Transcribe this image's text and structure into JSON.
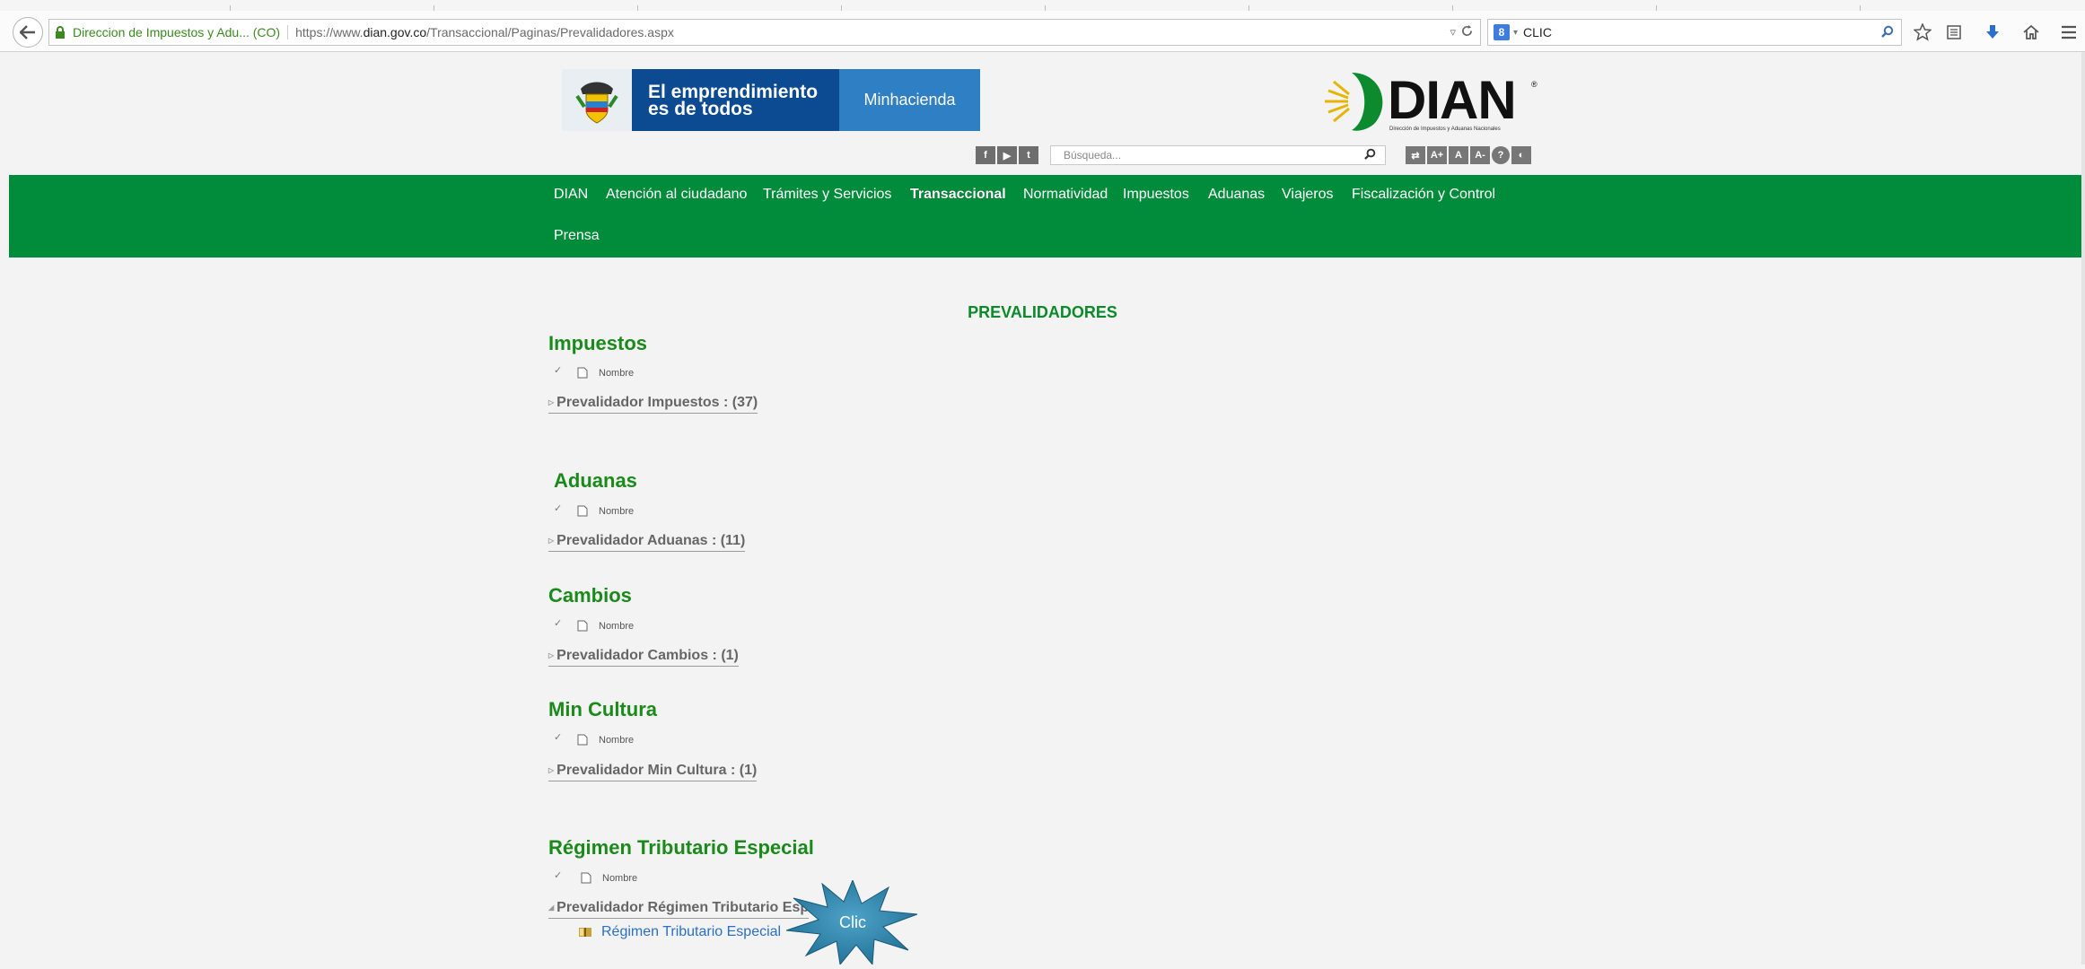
{
  "browser": {
    "identity": "Direccion de Impuestos y Adu... (CO)",
    "url_prefix": "https://www.",
    "url_domain": "dian.gov.co",
    "url_path": "/Transaccional/Paginas/Prevalidadores.aspx",
    "search_value": "CLIC",
    "search_engine_icon": "google-icon"
  },
  "header": {
    "slogan_line1": "El emprendimiento",
    "slogan_line2": "es de todos",
    "ministry": "Minhacienda",
    "dian_word": "DIAN",
    "dian_reg": "®",
    "dian_tagline": "Dirección de Impuestos y Aduanas Nacionales",
    "search_placeholder": "Búsqueda...",
    "social": [
      "f",
      "▶",
      "t"
    ],
    "access_tools": [
      "⇄",
      "A+",
      "A",
      "A-",
      "?",
      "◐"
    ]
  },
  "nav": {
    "items": [
      {
        "label": "DIAN"
      },
      {
        "label": "Atención al ciudadano"
      },
      {
        "label": "Trámites y Servicios"
      },
      {
        "label": "Transaccional",
        "active": true
      },
      {
        "label": "Normatividad"
      },
      {
        "label": "Impuestos"
      },
      {
        "label": "Aduanas"
      },
      {
        "label": "Viajeros"
      },
      {
        "label": "Fiscalización y Control"
      },
      {
        "label": "Prensa"
      }
    ]
  },
  "page": {
    "title": "PREVALIDADORES",
    "column_label": "Nombre",
    "sections": [
      {
        "title": "Impuestos",
        "group": "Prevalidador Impuestos : (37)"
      },
      {
        "title": "Aduanas",
        "group": "Prevalidador Aduanas : (11)"
      },
      {
        "title": "Cambios",
        "group": "Prevalidador Cambios : (1)"
      },
      {
        "title": "Min Cultura",
        "group": "Prevalidador Min Cultura : (1)"
      },
      {
        "title": "Régimen Tributario Especial",
        "group": "Prevalidador Régimen Tributario Esp",
        "expanded": true
      }
    ],
    "file_item": "Régimen Tributario Especial"
  },
  "callout": {
    "label": "Clic",
    "color": "#2b7fa6"
  },
  "colors": {
    "nav_green": "#008c3a",
    "section_green": "#1a8a1a",
    "link_blue": "#2a6fc9"
  }
}
